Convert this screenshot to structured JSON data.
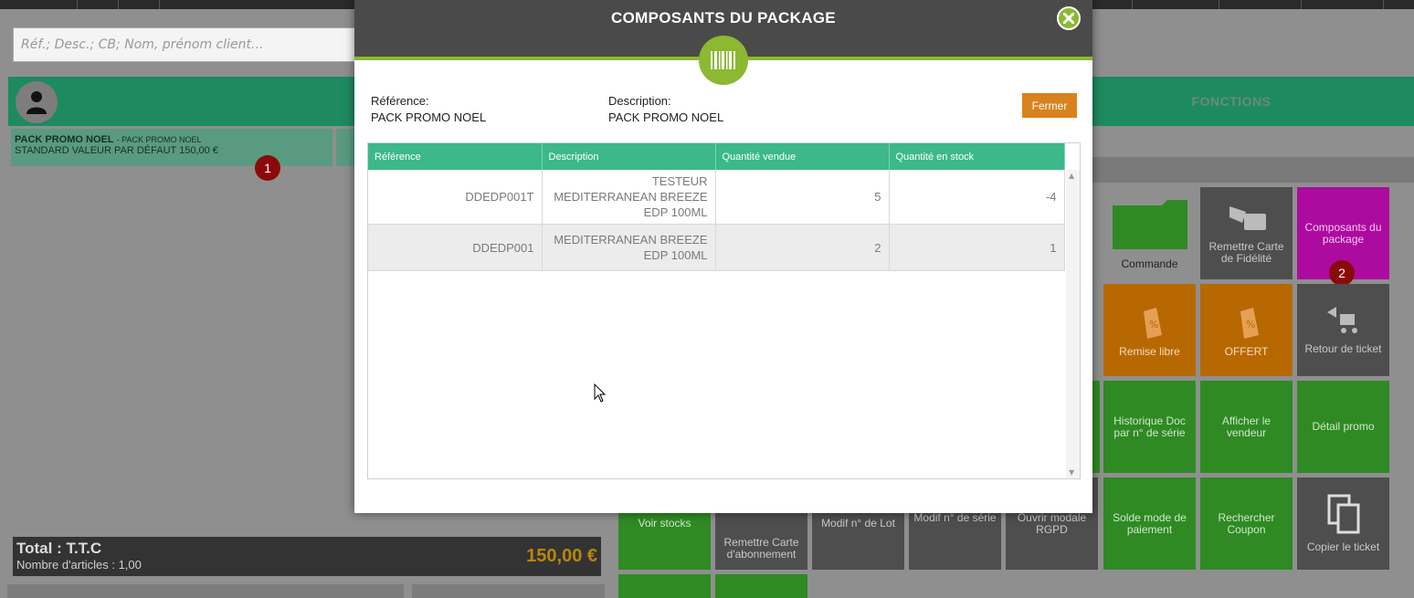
{
  "search": {
    "placeholder": "Réf.; Desc.; CB; Nom, prénom client..."
  },
  "header": {
    "fonctions_label": "FONCTIONS"
  },
  "ticket": {
    "line": {
      "title": "PACK PROMO NOEL",
      "subtitle": "PACK PROMO NOEL",
      "details": "STANDARD VALEUR PAR DÉFAUT 150,00 €"
    },
    "total_label": "Total : T.T.C",
    "count_label": "Nombre d'articles : 1,00",
    "total_amount": "150,00 €"
  },
  "badges": {
    "one": "1",
    "two": "2"
  },
  "tiles": {
    "commande": "Commande",
    "remettre_carte_fidelite": "Remettre Carte de Fidélité",
    "composants_package": "Composants du package",
    "remise_libre": "Remise libre",
    "offert": "OFFERT",
    "retour_ticket": "Retour de ticket",
    "historique_doc": "Historique Doc par n° de série",
    "afficher_vendeur": "Afficher le vendeur",
    "detail_promo": "Détail promo",
    "voir_stocks": "Voir stocks",
    "remettre_carte_abonnement": "Remettre Carte d'abonnement",
    "modif_lot": "Modif n° de Lot",
    "modif_serie": "Modif n° de série",
    "ouvrir_rgpd": "Ouvrir modale RGPD",
    "solde_mode_paiement": "Solde mode de paiement",
    "rechercher_coupon": "Rechercher Coupon",
    "copier_ticket": "Copier le ticket"
  },
  "modal": {
    "title": "COMPOSANTS DU PACKAGE",
    "reference_label": "Référence:",
    "reference_value": "PACK PROMO NOEL",
    "description_label": "Description:",
    "description_value": "PACK PROMO NOEL",
    "close_button": "Fermer",
    "table": {
      "headers": [
        "Référence",
        "Description",
        "Quantité vendue",
        "Quantité en stock"
      ],
      "rows": [
        {
          "ref": "DDEDP001T",
          "desc": "TESTEUR MEDITERRANEAN BREEZE EDP 100ML",
          "sold": "5",
          "stock": "-4"
        },
        {
          "ref": "DDEDP001",
          "desc": "MEDITERRANEAN BREEZE EDP 100ML",
          "sold": "2",
          "stock": "1"
        }
      ]
    }
  },
  "colors": {
    "modal_accent": "#8cb832",
    "table_header": "#3cb88a",
    "fermer_button": "#d8821e",
    "tile_magenta": "#ad0aa0",
    "tile_orange": "#b86800",
    "tile_green": "#2f8a24",
    "tile_grey": "#4e4e4e"
  },
  "icons": {
    "close": "close-icon",
    "barcode": "barcode-icon",
    "avatar": "user-icon",
    "folder": "folder-icon",
    "card": "card-icon",
    "tag": "discount-tag-icon",
    "return": "return-cart-icon",
    "copy": "copy-icon"
  }
}
